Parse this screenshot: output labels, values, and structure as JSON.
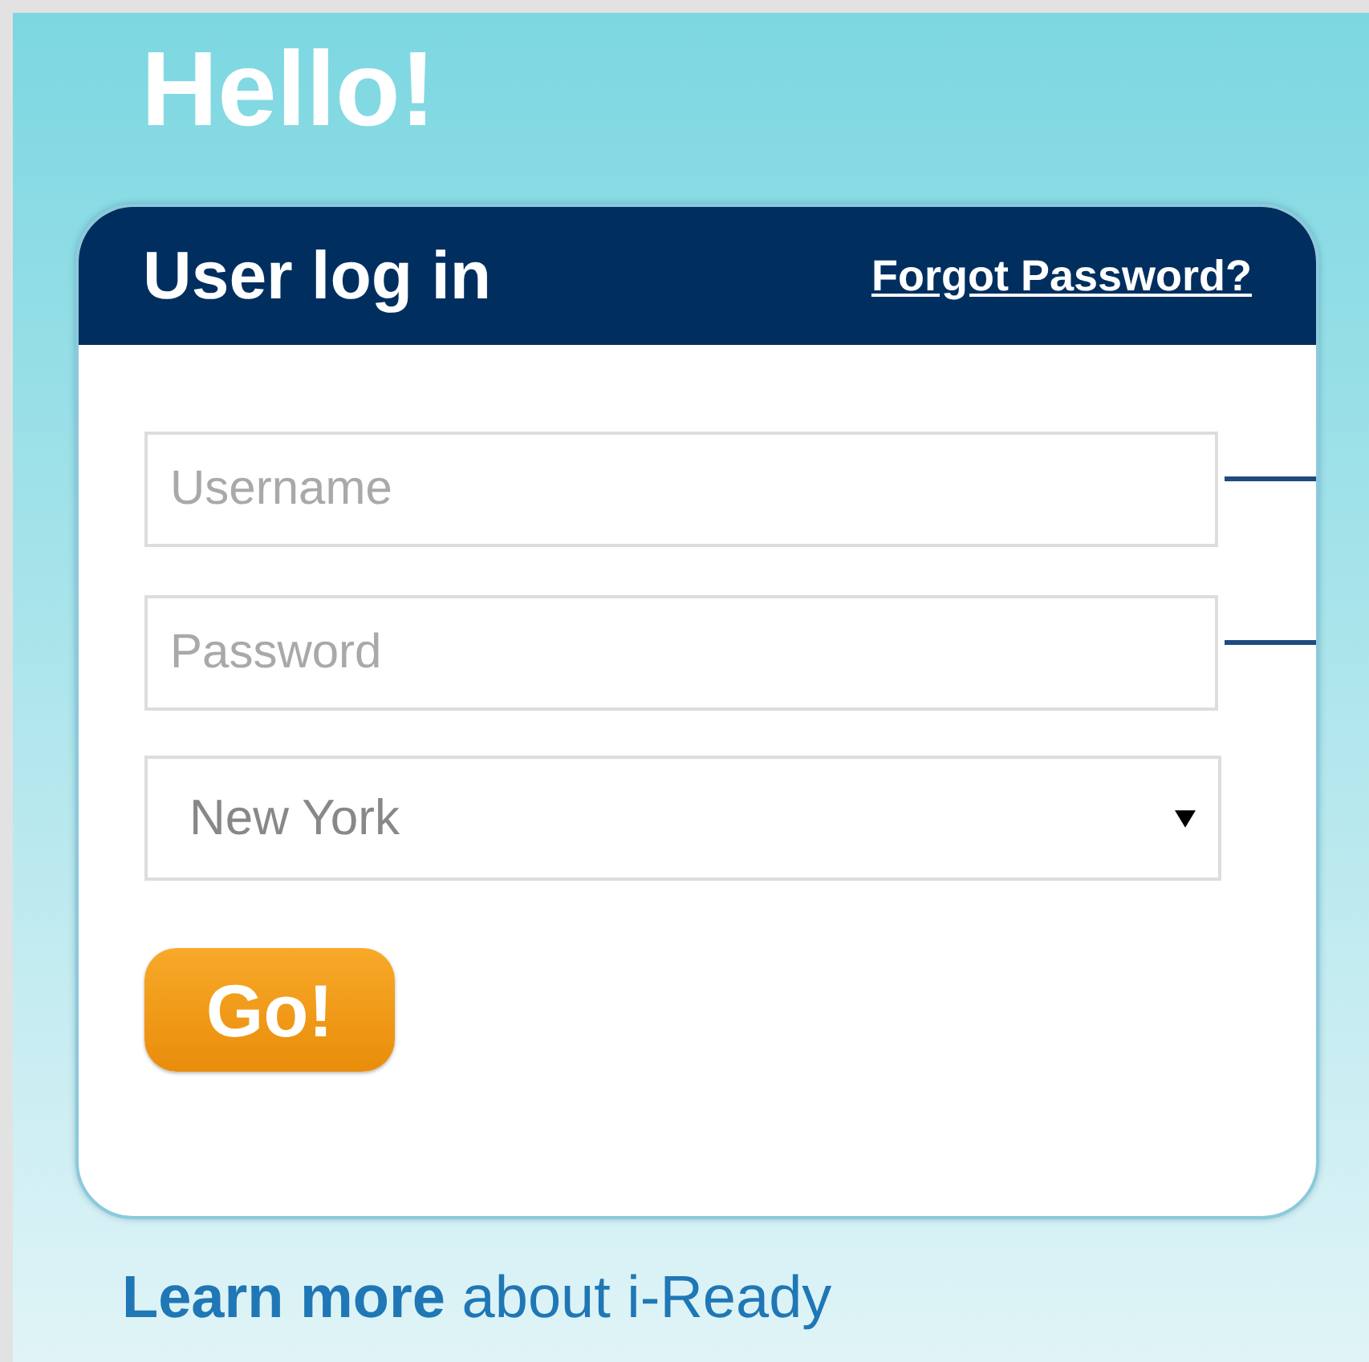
{
  "greeting": "Hello!",
  "login_card": {
    "title": "User log in",
    "forgot_link": "Forgot Password?",
    "fields": [
      {
        "placeholder": "Username"
      },
      {
        "placeholder": "Password"
      }
    ],
    "location_select": {
      "value": "New York"
    },
    "submit_button": "Go!"
  },
  "footer_link": {
    "bold": "Learn more",
    "rest": "about i-Ready"
  }
}
